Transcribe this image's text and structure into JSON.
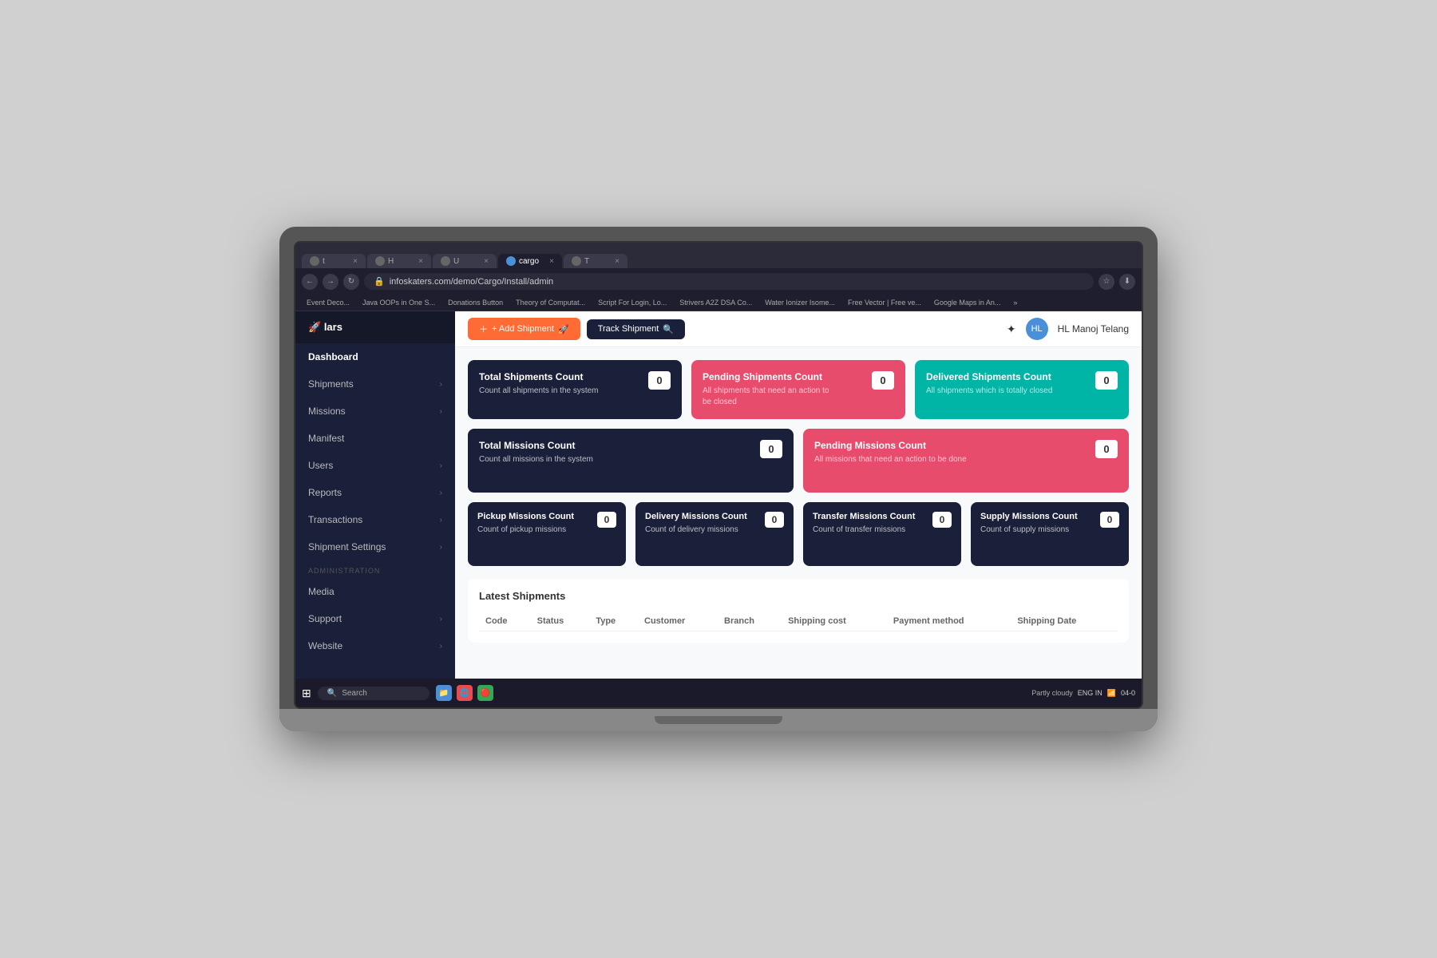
{
  "browser": {
    "url": "infoskaters.com/demo/Cargo/Install/admin",
    "tabs": [
      {
        "label": "t",
        "icon": "🔵",
        "active": false
      },
      {
        "label": "H",
        "icon": "🟠",
        "active": false
      },
      {
        "label": "U",
        "icon": "🔵",
        "active": false
      },
      {
        "label": "cargo",
        "icon": "🔵",
        "active": true
      },
      {
        "label": "T",
        "icon": "🔵",
        "active": false
      }
    ],
    "bookmarks": [
      "Event Deco...",
      "Java OOPs in One S...",
      "Donations Button",
      "Theory of Computat...",
      "Script For Login, Lo...",
      "Strivers A2Z DSA Co...",
      "Water Ionizer Isome...",
      "Free Vector | Free ve...",
      "Google Maps in An..."
    ]
  },
  "sidebar": {
    "logo": "lars",
    "items": [
      {
        "label": "Dashboard",
        "active": true,
        "hasChevron": false
      },
      {
        "label": "Shipments",
        "active": false,
        "hasChevron": true
      },
      {
        "label": "Missions",
        "active": false,
        "hasChevron": true
      },
      {
        "label": "Manifest",
        "active": false,
        "hasChevron": false
      },
      {
        "label": "Users",
        "active": false,
        "hasChevron": true
      },
      {
        "label": "Reports",
        "active": false,
        "hasChevron": true
      },
      {
        "label": "Transactions",
        "active": false,
        "hasChevron": true
      },
      {
        "label": "Shipment Settings",
        "active": false,
        "hasChevron": true
      }
    ],
    "adminSection": {
      "label": "ADMINISTRATION",
      "items": [
        {
          "label": "Media",
          "active": false,
          "hasChevron": false
        },
        {
          "label": "Support",
          "active": false,
          "hasChevron": true
        },
        {
          "label": "Website",
          "active": false,
          "hasChevron": true
        }
      ]
    }
  },
  "topbar": {
    "add_shipment_btn": "+ Add Shipment",
    "track_shipment_btn": "Track Shipment",
    "user_name": "HL Manoj Telang"
  },
  "stats": {
    "shipments_row": [
      {
        "title": "Total Shipments Count",
        "desc": "Count all shipments in the system",
        "value": "0",
        "theme": "dark"
      },
      {
        "title": "Pending Shipments Count",
        "desc": "All shipments that need an action to be closed",
        "value": "0",
        "theme": "red"
      },
      {
        "title": "Delivered Shipments Count",
        "desc": "All shipments which is totally closed",
        "value": "0",
        "theme": "teal"
      }
    ],
    "missions_row": [
      {
        "title": "Total Missions Count",
        "desc": "Count all missions in the system",
        "value": "0",
        "theme": "dark"
      },
      {
        "title": "Pending Missions Count",
        "desc": "All missions that need an action to be done",
        "value": "0",
        "theme": "red"
      }
    ],
    "sub_missions_row": [
      {
        "title": "Pickup Missions Count",
        "desc": "Count of pickup missions",
        "value": "0",
        "theme": "dark"
      },
      {
        "title": "Delivery Missions Count",
        "desc": "Count of delivery missions",
        "value": "0",
        "theme": "dark"
      },
      {
        "title": "Transfer Missions Count",
        "desc": "Count of transfer missions",
        "value": "0",
        "theme": "dark"
      },
      {
        "title": "Supply Missions Count",
        "desc": "Count of supply missions",
        "value": "0",
        "theme": "dark"
      }
    ]
  },
  "latest_shipments": {
    "title": "Latest Shipments",
    "columns": [
      "Code",
      "Status",
      "Type",
      "Customer",
      "Branch",
      "Shipping cost",
      "Payment method",
      "Shipping Date"
    ]
  },
  "taskbar": {
    "search_placeholder": "Search",
    "time": "04-0",
    "weather": "Partly cloudy",
    "lang": "ENG IN"
  }
}
